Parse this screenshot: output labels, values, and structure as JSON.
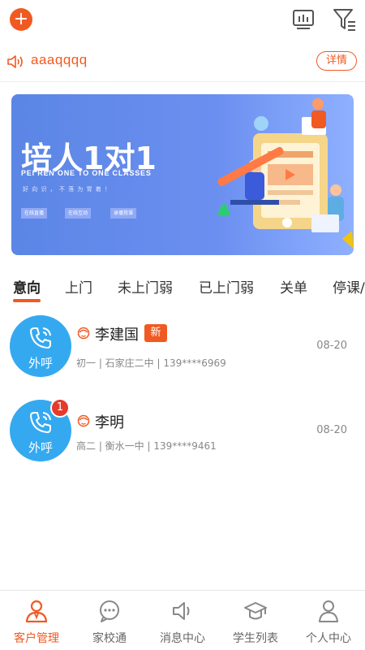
{
  "topbar": {
    "add_symbol": "+"
  },
  "notice": {
    "text": "aaaqqqq",
    "detail_label": "详情"
  },
  "banner": {
    "title": "培人1对1",
    "subtitle": "PEI REN ONE TO ONE CLASSES",
    "slogan": "好 向 识 ， 不 落 为 胃 着 ！",
    "tags": [
      "在线直播",
      "在线互动",
      "录播授课"
    ]
  },
  "tabs": [
    "意向",
    "上门",
    "未上门弱",
    "已上门弱",
    "关单",
    "停课/"
  ],
  "customers": [
    {
      "call_label": "外呼",
      "name": "李建国",
      "new_label": "新",
      "info": "初一 | 石家庄二中 | 139****6969",
      "date": "08-20",
      "badge": ""
    },
    {
      "call_label": "外呼",
      "name": "李明",
      "new_label": "",
      "info": "高二 | 衡水一中 | 139****9461",
      "date": "08-20",
      "badge": "1"
    }
  ],
  "nav": [
    {
      "label": "客户管理",
      "icon": "customer-icon",
      "active": true
    },
    {
      "label": "家校通",
      "icon": "chat-icon",
      "active": false
    },
    {
      "label": "消息中心",
      "icon": "speaker-icon",
      "active": false
    },
    {
      "label": "学生列表",
      "icon": "graduation-cap-icon",
      "active": false
    },
    {
      "label": "个人中心",
      "icon": "user-icon",
      "active": false
    }
  ],
  "colors": {
    "accent": "#f05a22",
    "call_blue": "#35a9f0",
    "badge_red": "#e53b2c"
  }
}
